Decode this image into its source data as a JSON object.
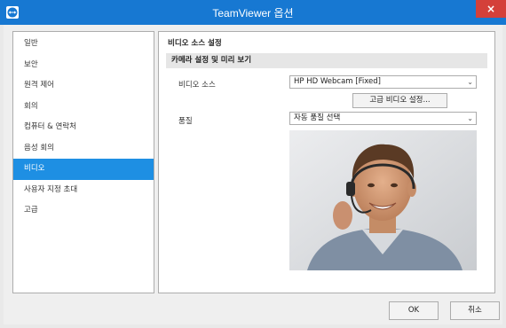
{
  "window": {
    "title": "TeamViewer 옵션",
    "close_label": "×"
  },
  "sidebar": {
    "items": [
      {
        "label": "일반"
      },
      {
        "label": "보안"
      },
      {
        "label": "원격 제어"
      },
      {
        "label": "회의"
      },
      {
        "label": "컴퓨터 & 연락처"
      },
      {
        "label": "음성 회의"
      },
      {
        "label": "비디오"
      },
      {
        "label": "사용자 지정 초대"
      },
      {
        "label": "고급"
      }
    ],
    "selected": "비디오"
  },
  "content": {
    "section_title": "비디오 소스 설정",
    "subheader": "카메라 설정 및 미리 보기",
    "video_source_label": "비디오 소스",
    "video_source_value": "HP HD Webcam [Fixed]",
    "advanced_video_button": "고급 비디오 설정...",
    "quality_label": "품질",
    "quality_value": "자동 품질 선택"
  },
  "footer": {
    "ok_label": "OK",
    "cancel_label": "취소"
  },
  "colors": {
    "titlebar": "#1778d2",
    "selection": "#1e8fe3",
    "close": "#d4403a"
  }
}
